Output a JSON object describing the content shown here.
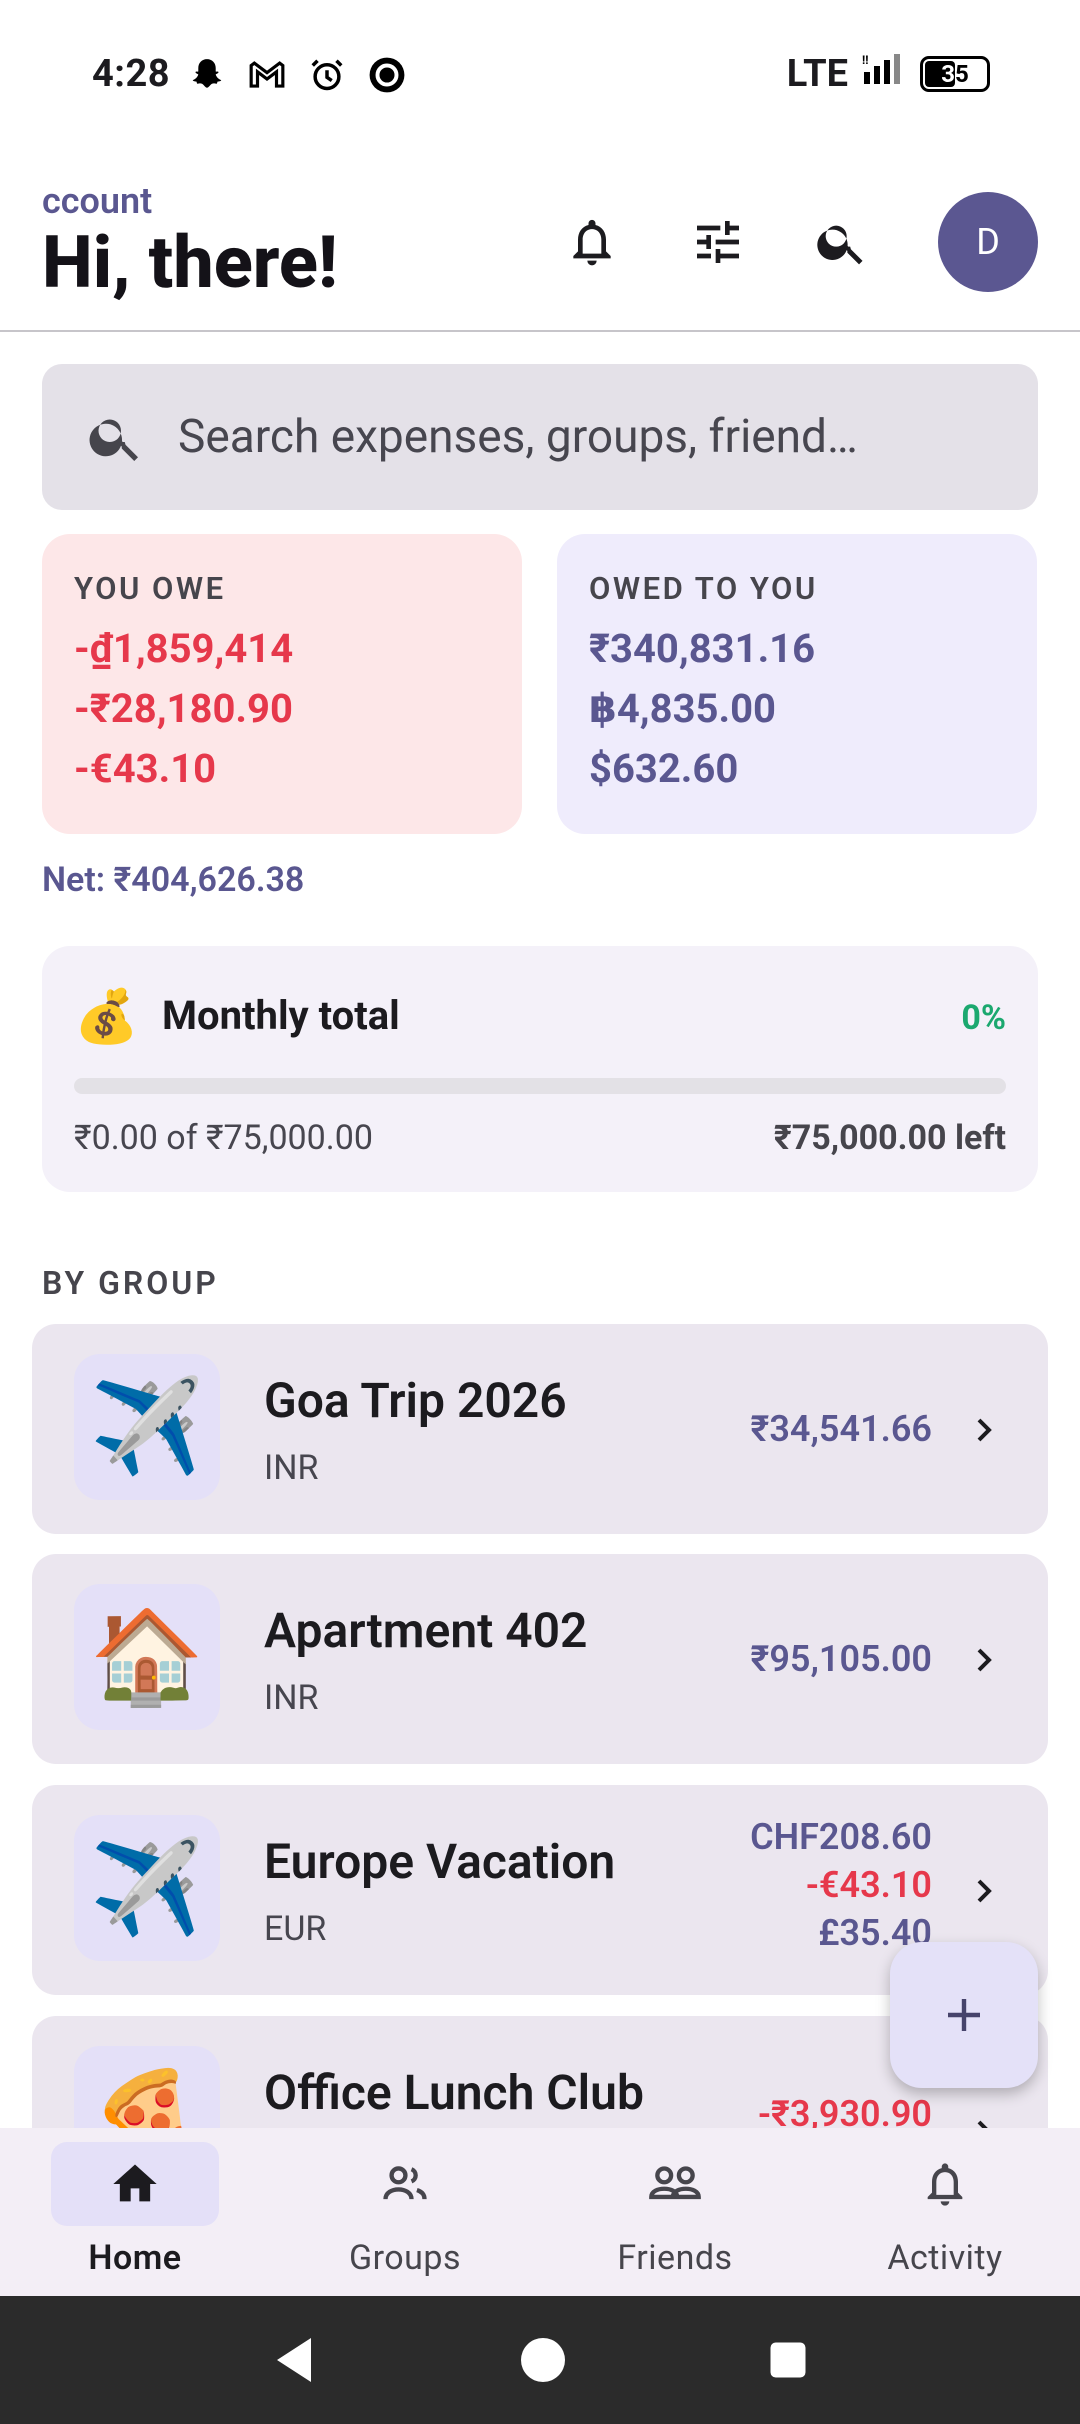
{
  "status_bar": {
    "time": "4:28",
    "network": "LTE",
    "battery": "35",
    "notification_icons": [
      "snapchat-icon",
      "gmail-icon",
      "alarm-icon",
      "circle-app-icon"
    ]
  },
  "header": {
    "subtitle": "ccount",
    "title": "Hi, there!",
    "avatar_initial": "D"
  },
  "search": {
    "placeholder": "Search expenses, groups, friend…"
  },
  "balances": {
    "you_owe": {
      "label": "YOU OWE",
      "amounts": [
        "-₫1,859,414",
        "-₹28,180.90",
        "-€43.10"
      ]
    },
    "owed_to_you": {
      "label": "OWED TO YOU",
      "amounts": [
        "₹340,831.16",
        "฿4,835.00",
        "$632.60"
      ]
    },
    "net": "Net: ₹404,626.38"
  },
  "monthly": {
    "emoji": "💰",
    "title": "Monthly total",
    "percent": "0%",
    "progress_fraction": 0,
    "spent": "₹0.00 of ₹75,000.00",
    "left": "₹75,000.00 left"
  },
  "section_label": "BY GROUP",
  "groups": [
    {
      "emoji": "✈️",
      "name": "Goa Trip 2026",
      "currency": "INR",
      "amounts": [
        {
          "text": "₹34,541.66",
          "type": "pos"
        }
      ]
    },
    {
      "emoji": "🏠",
      "name": "Apartment 402",
      "currency": "INR",
      "amounts": [
        {
          "text": "₹95,105.00",
          "type": "pos"
        }
      ]
    },
    {
      "emoji": "✈️",
      "name": "Europe Vacation",
      "currency": "EUR",
      "amounts": [
        {
          "text": "CHF208.60",
          "type": "pos"
        },
        {
          "text": "-€43.10",
          "type": "neg"
        },
        {
          "text": "£35.40",
          "type": "pos"
        }
      ]
    },
    {
      "emoji": "🍕",
      "name": "Office Lunch Club",
      "currency": "",
      "amounts": [
        {
          "text": "-₹3,930.90",
          "type": "neg"
        }
      ]
    }
  ],
  "bottom_nav": [
    {
      "label": "Home",
      "icon": "home-icon",
      "active": true
    },
    {
      "label": "Groups",
      "icon": "groups-icon",
      "active": false
    },
    {
      "label": "Friends",
      "icon": "friends-icon",
      "active": false
    },
    {
      "label": "Activity",
      "icon": "bell-icon",
      "active": false
    }
  ],
  "colors": {
    "accent": "#5b5791",
    "negative": "#e6384b",
    "positive_pct": "#1ba86f"
  }
}
